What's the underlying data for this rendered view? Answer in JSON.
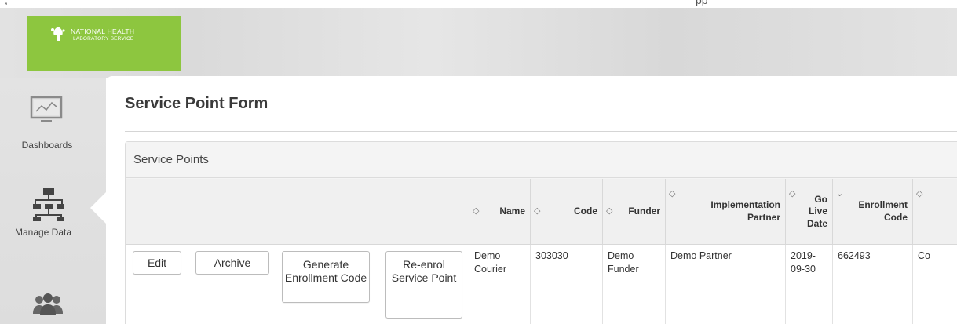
{
  "header": {
    "top_crop_left": ",",
    "top_crop_right": "pp",
    "logo": {
      "line1": "NATIONAL HEALTH",
      "line2": "LABORATORY SERVICE",
      "brand_color": "#8dc63f"
    }
  },
  "sidebar": {
    "items": [
      {
        "label": "Dashboards",
        "icon": "chart-monitor-icon"
      },
      {
        "label": "Manage Data",
        "icon": "hierarchy-icon",
        "active": true
      },
      {
        "label": "",
        "icon": "users-icon"
      }
    ]
  },
  "main": {
    "title": "Service Point Form",
    "panel": {
      "heading": "Service Points",
      "columns": [
        {
          "label": "",
          "sortable": false
        },
        {
          "label": "Name",
          "sortable": true
        },
        {
          "label": "Code",
          "sortable": true
        },
        {
          "label": "Funder",
          "sortable": true
        },
        {
          "label": "Implementation Partner",
          "sortable": true
        },
        {
          "label": "Go Live Date",
          "sortable": true
        },
        {
          "label": "Enrollment Code",
          "sortable": true,
          "sort_direction": "descending"
        },
        {
          "label": "",
          "sortable": true
        }
      ],
      "rows": [
        {
          "actions": [
            "Edit",
            "Archive",
            "Generate Enrollment Code",
            "Re-enrol Service Point"
          ],
          "name": "Demo Courier",
          "code": "303030",
          "funder": "Demo Funder",
          "implementation_partner": "Demo Partner",
          "go_live_date": "2019-09-30",
          "enrollment_code": "662493",
          "next_cell": "Co"
        }
      ]
    }
  }
}
